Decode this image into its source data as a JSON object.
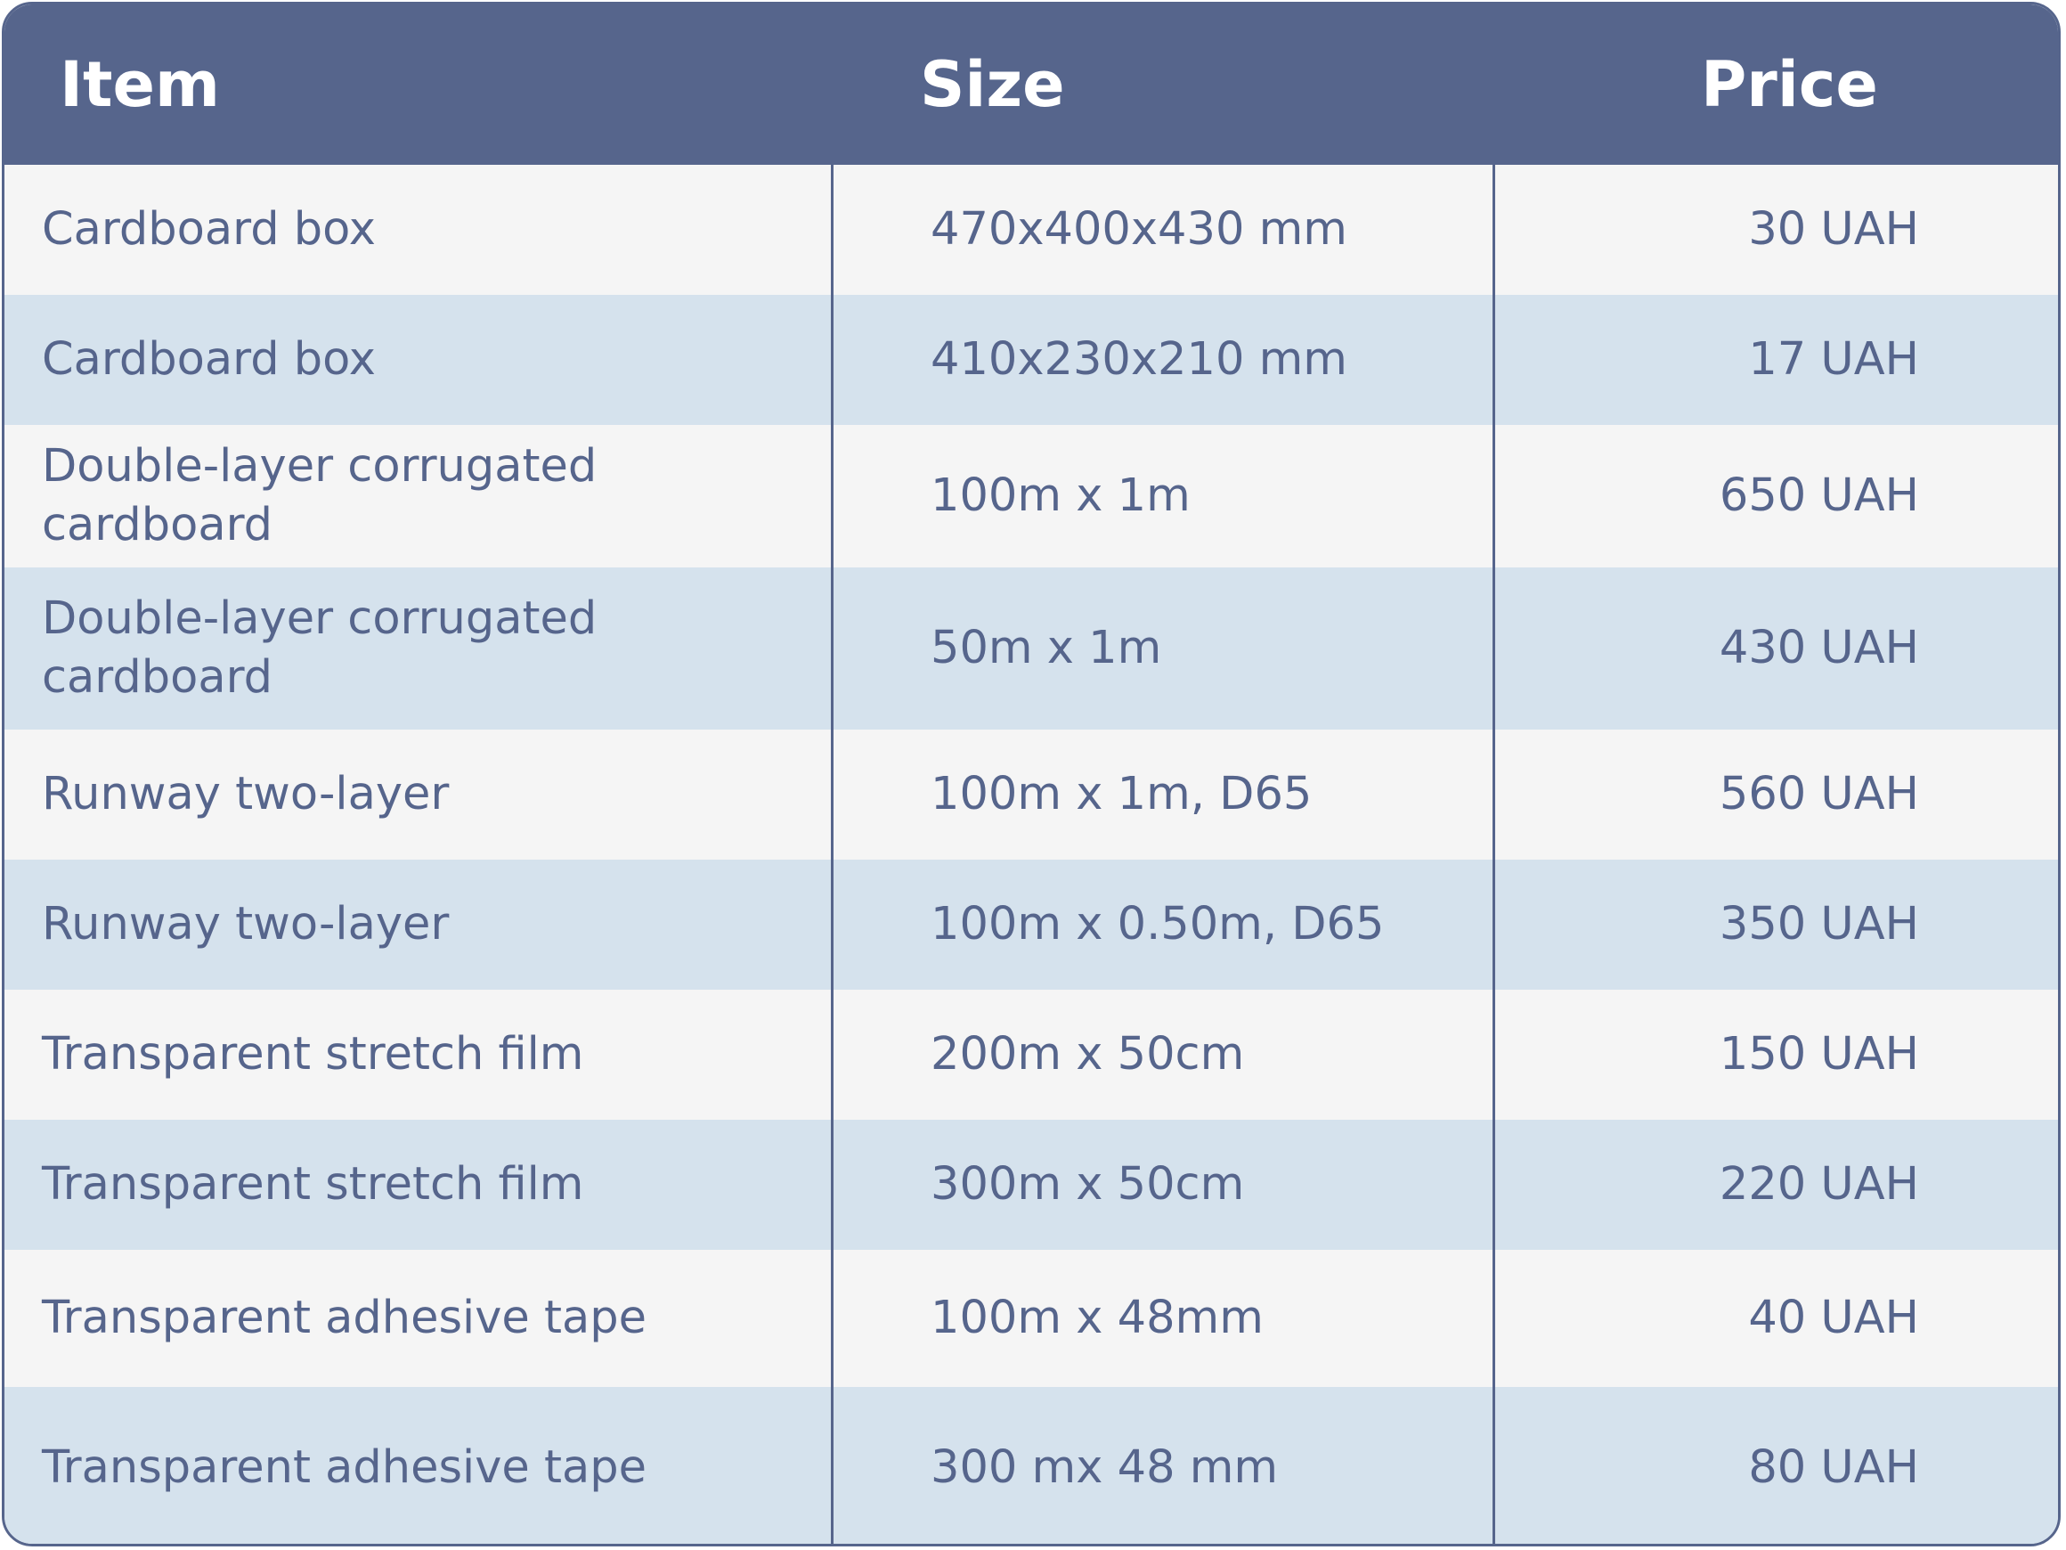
{
  "header": {
    "item": "Item",
    "size": "Size",
    "price": "Price"
  },
  "rows": [
    {
      "item": "Cardboard box",
      "size": "470x400x430 mm",
      "price": "30 UAH"
    },
    {
      "item": "Cardboard box",
      "size": "410x230x210 mm",
      "price": "17 UAH"
    },
    {
      "item": "Double-layer corrugated cardboard",
      "size": "100m x 1m",
      "price": "650 UAH"
    },
    {
      "item": "Double-layer corrugated cardboard",
      "size": "50m x 1m",
      "price": "430 UAH"
    },
    {
      "item": "Runway two-layer",
      "size": "100m x 1m, D65",
      "price": "560 UAH"
    },
    {
      "item": "Runway two-layer",
      "size": "100m x 0.50m, D65",
      "price": "350 UAH"
    },
    {
      "item": "Transparent stretch film",
      "size": "200m x 50cm",
      "price": "150 UAH"
    },
    {
      "item": "Transparent stretch film",
      "size": "300m x 50cm",
      "price": "220 UAH"
    },
    {
      "item": "Transparent adhesive tape",
      "size": "100m x 48mm",
      "price": "40 UAH"
    },
    {
      "item": "Transparent adhesive tape",
      "size": "300 mx 48 mm",
      "price": "80 UAH"
    }
  ],
  "colors": {
    "header_bg": "#56658c",
    "header_text": "#ffffff",
    "row_light": "#f5f5f5",
    "row_blue": "#d5e2ed",
    "cell_text": "#56658c"
  }
}
